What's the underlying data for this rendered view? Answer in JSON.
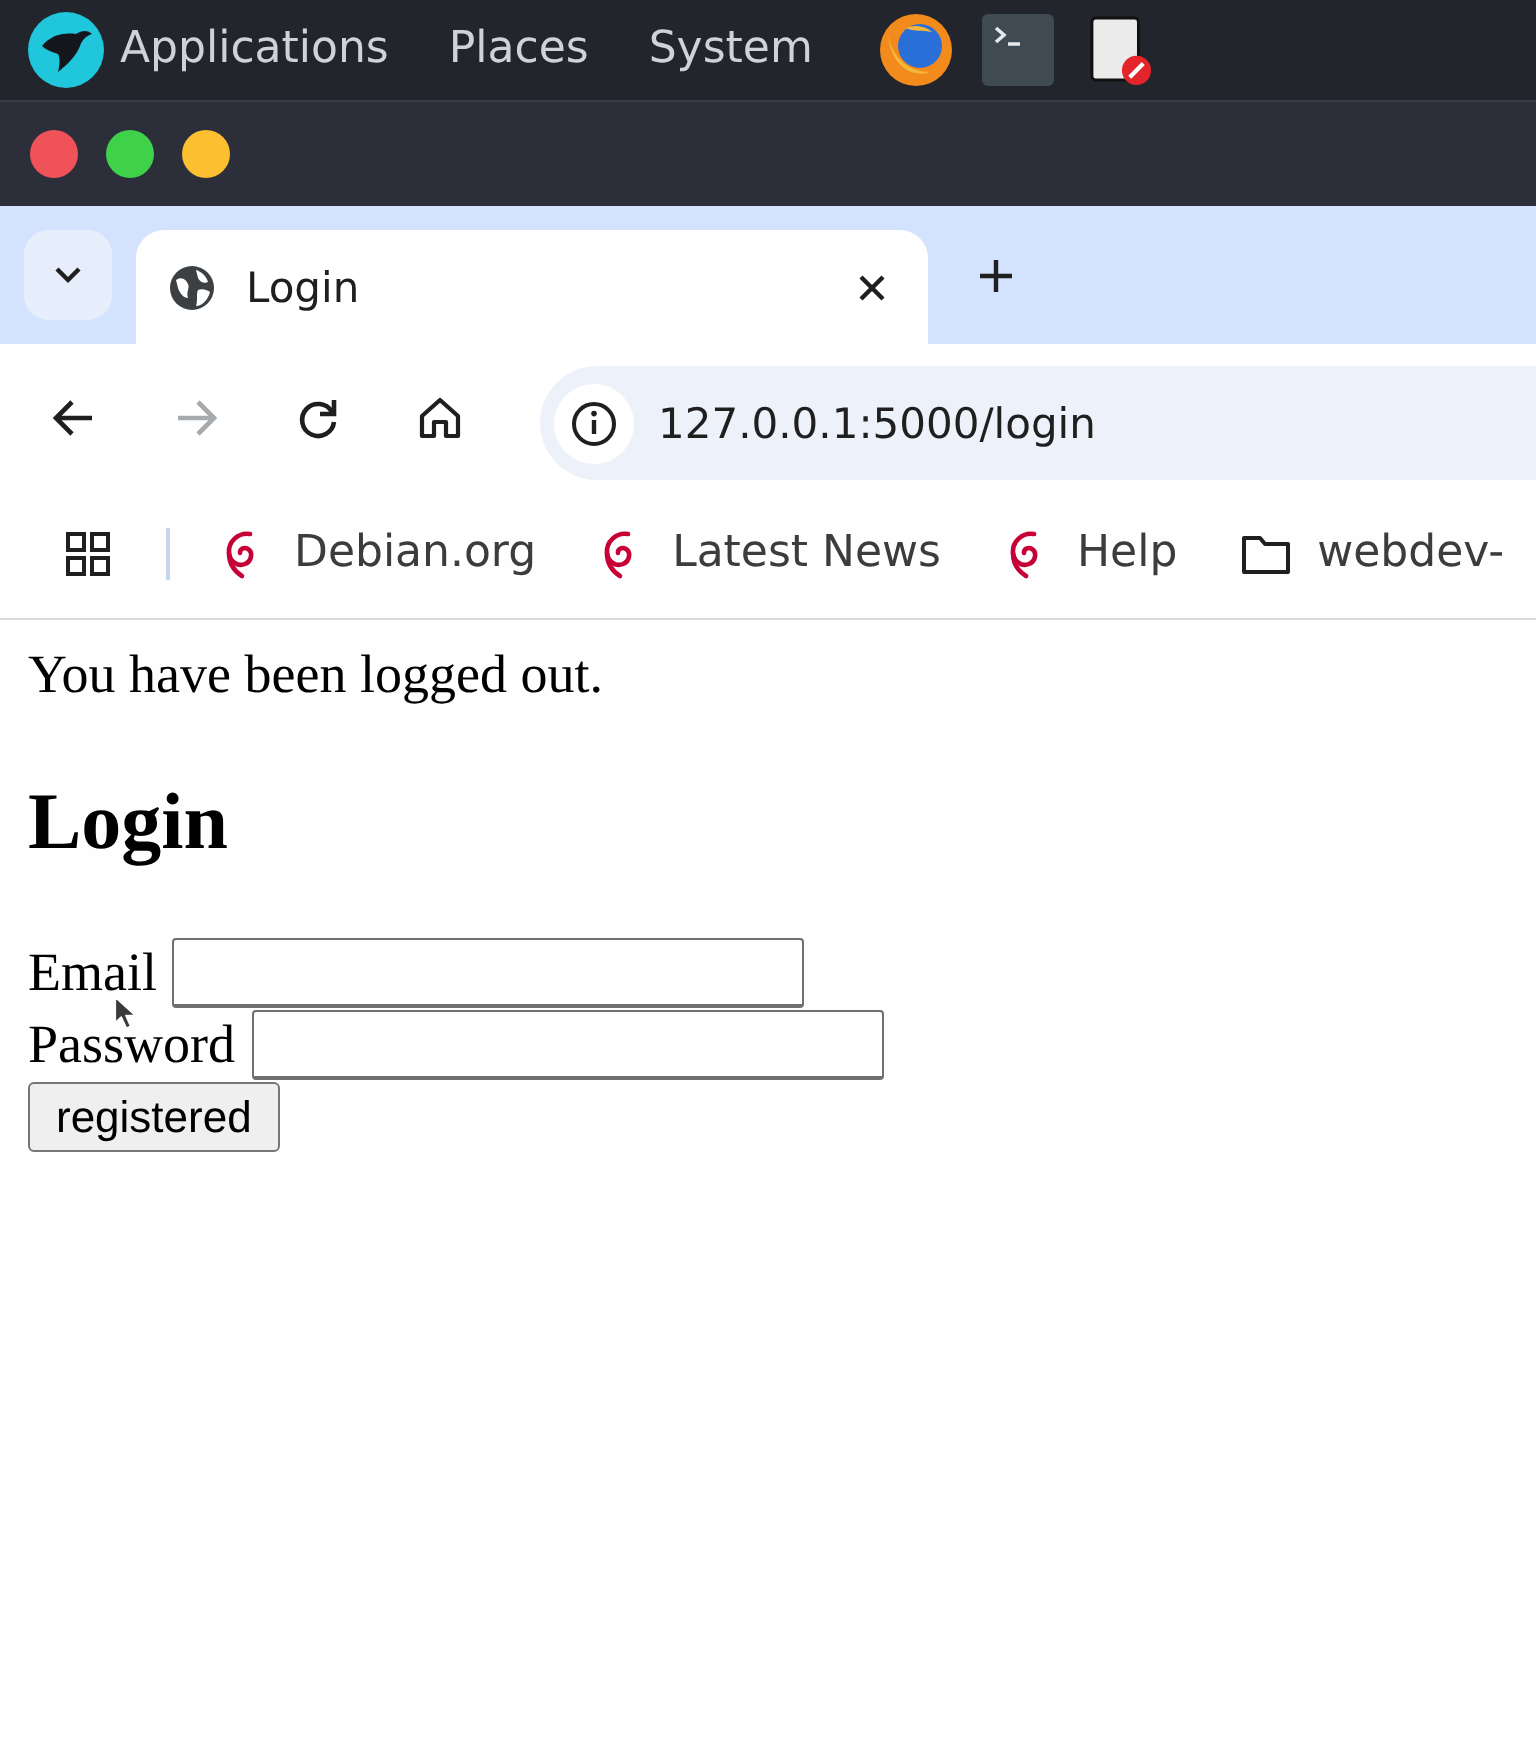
{
  "top_panel": {
    "menus": [
      "Applications",
      "Places",
      "System"
    ],
    "launchers": [
      {
        "kind": "browser"
      },
      {
        "kind": "terminal"
      },
      {
        "kind": "document"
      }
    ]
  },
  "window_controls": [
    {
      "color": "#f0525a"
    },
    {
      "color": "#3fd14a"
    },
    {
      "color": "#fbbf2f"
    }
  ],
  "tabs": [
    {
      "title": "Login",
      "selected": true
    }
  ],
  "nav_buttons": [
    {
      "kind": "back",
      "disabled": false
    },
    {
      "kind": "forward",
      "disabled": true
    },
    {
      "kind": "reload",
      "disabled": false
    },
    {
      "kind": "home",
      "disabled": false
    }
  ],
  "address_bar": {
    "url": "127.0.0.1:5000/login"
  },
  "bookmarks": [
    {
      "kind": "site",
      "label": "Debian.org"
    },
    {
      "kind": "site",
      "label": "Latest News"
    },
    {
      "kind": "site",
      "label": "Help"
    },
    {
      "kind": "folder",
      "label": "webdev-"
    }
  ],
  "page": {
    "message": "You have been logged out.",
    "heading": "Login",
    "fields": [
      {
        "label": "Email"
      },
      {
        "label": "Password"
      }
    ],
    "submit": "registered"
  }
}
